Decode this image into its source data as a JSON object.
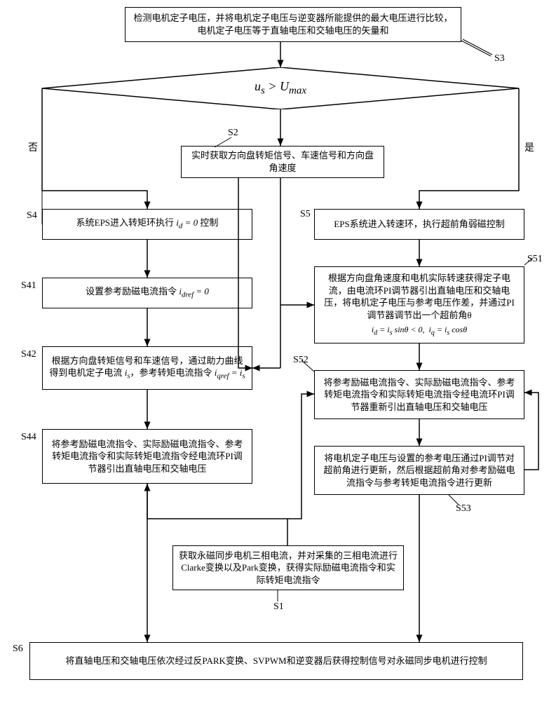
{
  "flow": {
    "top": "检测电机定子电压，并将电机定子电压与逆变器所能提供的最大电压进行比较，电机定子电压等于直轴电压和交轴电压的矢量和",
    "decision": "uₛ > Uₘₐₓ",
    "labels": {
      "no": "否",
      "yes": "是"
    },
    "s2": "实时获取方向盘转矩信号、车速信号和方向盘角速度",
    "s4": "系统EPS进入转矩环执行 i_d = 0 控制",
    "s41": "设置参考励磁电流指令 i_dref = 0",
    "s42": "根据方向盘转矩信号和车速信号，通过助力曲线得到电机定子电流 iₛ，参考转矩电流指令 i_qref = iₛ",
    "s44": "将参考励磁电流指令、实际励磁电流指令、参考转矩电流指令和实际转矩电流指令经电流环PI调节器引出直轴电压和交轴电压",
    "s5": "EPS系统进入转速环，执行超前角弱磁控制",
    "s51_main": "根据方向盘角速度和电机实际转速获得定子电流，由电流环PI调节器引出直轴电压和交轴电压，将电机定子电压与参考电压作差，并通过PI调节器调节出一个超前角θ",
    "s51_eq": "i_d = iₛ sinθ < 0,  i_q = iₛ cosθ",
    "s52": "将参考励磁电流指令、实际励磁电流指令、参考转矩电流指令和实际转矩电流指令经电流环PI调节器重新引出直轴电压和交轴电压",
    "s53": "将电机定子电压与设置的参考电压通过PI调节对超前角进行更新，然后根据超前角对参考励磁电流指令与参考转矩电流指令进行更新",
    "s1": "获取永磁同步电机三相电流，并对采集的三相电流进行Clarke变换以及Park变换，获得实际励磁电流指令和实际转矩电流指令",
    "s6": "将直轴电压和交轴电压依次经过反PARK变换、SVPWM和逆变器后获得控制信号对永磁同步电机进行控制"
  },
  "tags": {
    "s1": "S1",
    "s2": "S2",
    "s3": "S3",
    "s4": "S4",
    "s5": "S5",
    "s41": "S41",
    "s42": "S42",
    "s44": "S44",
    "s51": "S51",
    "s52": "S52",
    "s53": "S53",
    "s6": "S6"
  }
}
